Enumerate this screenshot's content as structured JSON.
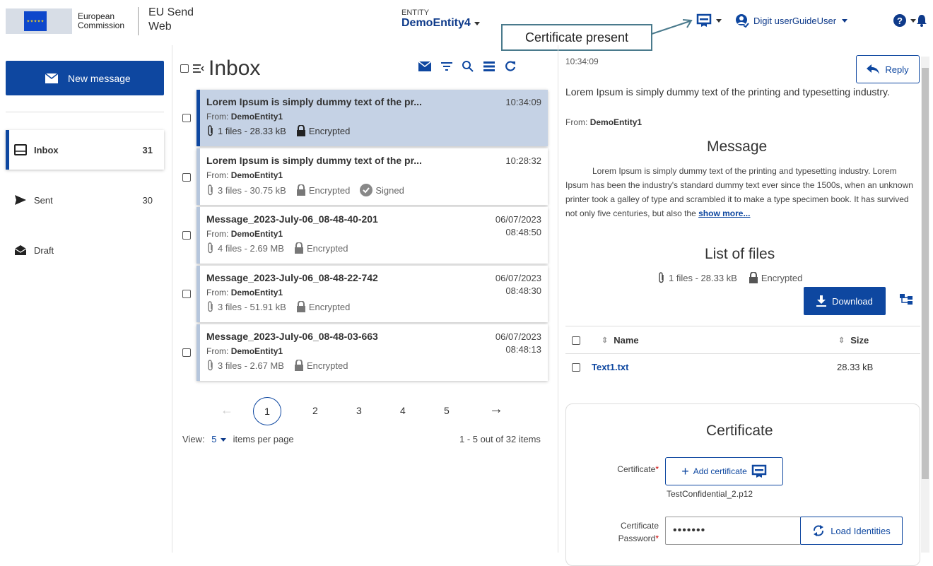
{
  "header": {
    "logo_line1": "European",
    "logo_line2": "Commission",
    "app_title_line1": "EU Send",
    "app_title_line2": "Web",
    "entity_label": "ENTITY",
    "entity_name": "DemoEntity4",
    "callout": "Certificate present",
    "user_name": "Digit userGuideUser"
  },
  "sidebar": {
    "new_message": "New message",
    "items": [
      {
        "label": "Inbox",
        "count": "31"
      },
      {
        "label": "Sent",
        "count": "30"
      },
      {
        "label": "Draft",
        "count": ""
      }
    ]
  },
  "inbox": {
    "title": "Inbox",
    "messages": [
      {
        "subject": "Lorem Ipsum is simply dummy text of the pr...",
        "from_label": "From:",
        "from": "DemoEntity1",
        "files": "1 files - 28.33 kB",
        "encryption": "Encrypted",
        "signed": "",
        "date": "",
        "time": "10:34:09"
      },
      {
        "subject": "Lorem Ipsum is simply dummy text of the pr...",
        "from_label": "From:",
        "from": "DemoEntity1",
        "files": "3 files - 30.75 kB",
        "encryption": "Encrypted",
        "signed": "Signed",
        "date": "",
        "time": "10:28:32"
      },
      {
        "subject": "Message_2023-July-06_08-48-40-201",
        "from_label": "From:",
        "from": "DemoEntity1",
        "files": "4 files - 2.69 MB",
        "encryption": "Encrypted",
        "signed": "",
        "date": "06/07/2023",
        "time": "08:48:50"
      },
      {
        "subject": "Message_2023-July-06_08-48-22-742",
        "from_label": "From:",
        "from": "DemoEntity1",
        "files": "3 files - 51.91 kB",
        "encryption": "Encrypted",
        "signed": "",
        "date": "06/07/2023",
        "time": "08:48:30"
      },
      {
        "subject": "Message_2023-July-06_08-48-03-663",
        "from_label": "From:",
        "from": "DemoEntity1",
        "files": "3 files - 2.67 MB",
        "encryption": "Encrypted",
        "signed": "",
        "date": "06/07/2023",
        "time": "08:48:13"
      }
    ],
    "pagination": {
      "prev": "←",
      "pages": [
        "1",
        "2",
        "3",
        "4",
        "5"
      ],
      "current": "1",
      "next": "→"
    },
    "view_label": "View:",
    "per_page": "5",
    "per_page_suffix": "items per page",
    "items_count": "1 - 5 out of 32 items"
  },
  "detail": {
    "time": "10:34:09",
    "reply": "Reply",
    "subject": "Lorem Ipsum is simply dummy text of the printing and typesetting industry.",
    "from_label": "From:",
    "from": "DemoEntity1",
    "message_title": "Message",
    "body": "Lorem Ipsum is simply dummy text of the printing and typesetting industry. Lorem Ipsum has been the industry's standard dummy text ever since the 1500s, when an unknown printer took a galley of type and scrambled it to make a type specimen book. It has survived not only five centuries, but also the",
    "show_more": "show more...",
    "files_title": "List of files",
    "files_meta": "1 files - 28.33 kB",
    "files_encryption": "Encrypted",
    "download": "Download",
    "table": {
      "col_name": "Name",
      "col_size": "Size",
      "rows": [
        {
          "name": "Text1.txt",
          "size": "28.33 kB"
        }
      ]
    },
    "certificate_title": "Certificate",
    "cert_label": "Certificate",
    "add_cert": "Add certificate",
    "cert_file": "TestConfidential_2.p12",
    "pwd_label_1": "Certificate",
    "pwd_label_2": "Password",
    "pwd_value": "•••••••",
    "load_identities": "Load Identities"
  },
  "colors": {
    "primary": "#0e47a0",
    "selected_row": "#c5d2e5",
    "callout_border": "#4a7a8c"
  }
}
